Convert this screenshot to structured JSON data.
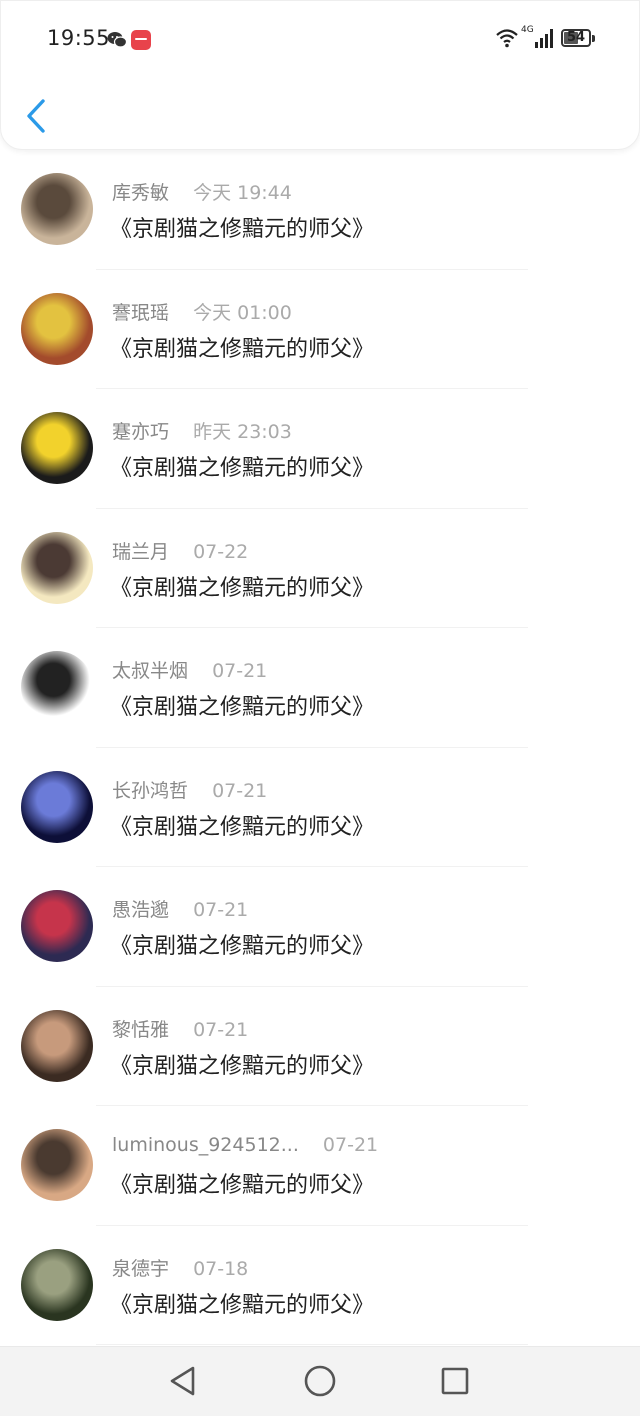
{
  "status_bar": {
    "time": "19:55",
    "network": "4G",
    "battery": "54",
    "icons": [
      "wechat-icon",
      "app-notification-icon",
      "wifi-icon",
      "signal-icon",
      "battery-icon"
    ]
  },
  "header": {
    "back_icon": "chevron-left-icon",
    "accent_color": "#2b9ae8"
  },
  "comments": [
    {
      "name": "库秀敏",
      "date": "今天 19:44",
      "title": "《京剧猫之修黯元的师父》",
      "avatar_colors": [
        "#c9b49a",
        "#5a4a3c"
      ]
    },
    {
      "name": "謇珉瑶",
      "date": "今天 01:00",
      "title": "《京剧猫之修黯元的师父》",
      "avatar_colors": [
        "#a34b2c",
        "#e3c240"
      ]
    },
    {
      "name": "蹇亦巧",
      "date": "昨天 23:03",
      "title": "《京剧猫之修黯元的师父》",
      "avatar_colors": [
        "#1b1b1b",
        "#f2d22c"
      ]
    },
    {
      "name": "瑞兰月",
      "date": "07-22",
      "title": "《京剧猫之修黯元的师父》",
      "avatar_colors": [
        "#f4e8c0",
        "#4b3a34"
      ]
    },
    {
      "name": "太叔半烟",
      "date": "07-21",
      "title": "《京剧猫之修黯元的师父》",
      "avatar_colors": [
        "#ffffff",
        "#222222"
      ]
    },
    {
      "name": "长孙鸿哲",
      "date": "07-21",
      "title": "《京剧猫之修黯元的师父》",
      "avatar_colors": [
        "#0d0f38",
        "#6b7bd8"
      ]
    },
    {
      "name": "愚浩邈",
      "date": "07-21",
      "title": "《京剧猫之修黯元的师父》",
      "avatar_colors": [
        "#2d2a52",
        "#c6344b"
      ]
    },
    {
      "name": "黎恬雅",
      "date": "07-21",
      "title": "《京剧猫之修黯元的师父》",
      "avatar_colors": [
        "#3b2b22",
        "#c79a7c"
      ]
    },
    {
      "name": "luminous_924512...",
      "date": "07-21",
      "title": "《京剧猫之修黯元的师父》",
      "avatar_colors": [
        "#d8a884",
        "#4a3a30"
      ]
    },
    {
      "name": "泉德宇",
      "date": "07-18",
      "title": "《京剧猫之修黯元的师父》",
      "avatar_colors": [
        "#2a3520",
        "#9aa080"
      ]
    }
  ],
  "nav_bar": {
    "icons": [
      "back-triangle-icon",
      "home-circle-icon",
      "recents-square-icon"
    ]
  }
}
